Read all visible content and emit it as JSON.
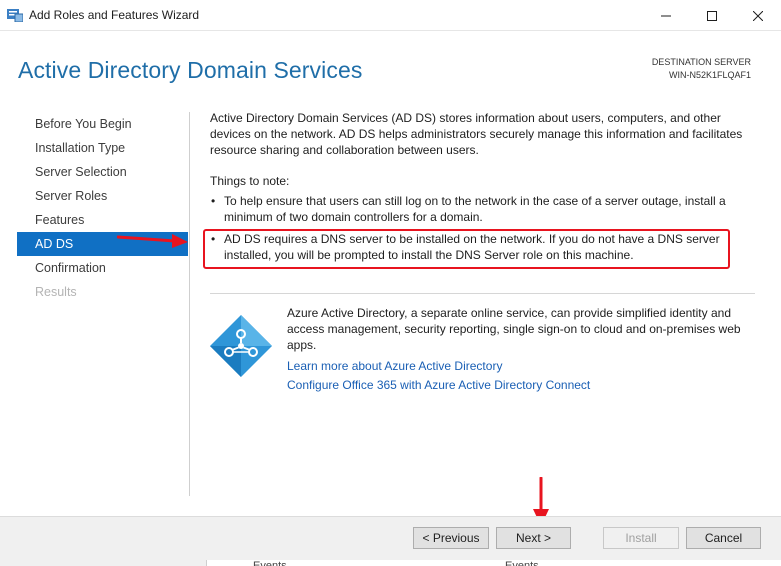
{
  "window": {
    "title": "Add Roles and Features Wizard"
  },
  "header": {
    "title": "Active Directory Domain Services",
    "destination_label": "DESTINATION SERVER",
    "destination_value": "WIN-N52K1FLQAF1"
  },
  "nav": {
    "items": [
      {
        "label": "Before You Begin",
        "state": "normal"
      },
      {
        "label": "Installation Type",
        "state": "normal"
      },
      {
        "label": "Server Selection",
        "state": "normal"
      },
      {
        "label": "Server Roles",
        "state": "normal"
      },
      {
        "label": "Features",
        "state": "normal"
      },
      {
        "label": "AD DS",
        "state": "active"
      },
      {
        "label": "Confirmation",
        "state": "normal"
      },
      {
        "label": "Results",
        "state": "disabled"
      }
    ]
  },
  "content": {
    "description": "Active Directory Domain Services (AD DS) stores information about users, computers, and other devices on the network.  AD DS helps administrators securely manage this information and facilitates resource sharing and collaboration between users.",
    "notes_heading": "Things to note:",
    "notes": [
      "To help ensure that users can still log on to the network in the case of a server outage, install a minimum of two domain controllers for a domain.",
      "AD DS requires a DNS server to be installed on the network.  If you do not have a DNS server installed, you will be prompted to install the DNS Server role on this machine."
    ],
    "azure": {
      "text": "Azure Active Directory, a separate online service, can provide simplified identity and access management, security reporting, single sign-on to cloud and on-premises web apps.",
      "links": [
        "Learn more about Azure Active Directory",
        "Configure Office 365 with Azure Active Directory Connect"
      ]
    }
  },
  "footer": {
    "previous": "< Previous",
    "next": "Next >",
    "install": "Install",
    "cancel": "Cancel"
  },
  "background": {
    "text_left": "Events",
    "text_right": "Events"
  },
  "colors": {
    "title_blue": "#1f6ea8",
    "nav_active": "#1070c4",
    "highlight_red": "#e8141f",
    "link_blue": "#1a5fb4"
  }
}
